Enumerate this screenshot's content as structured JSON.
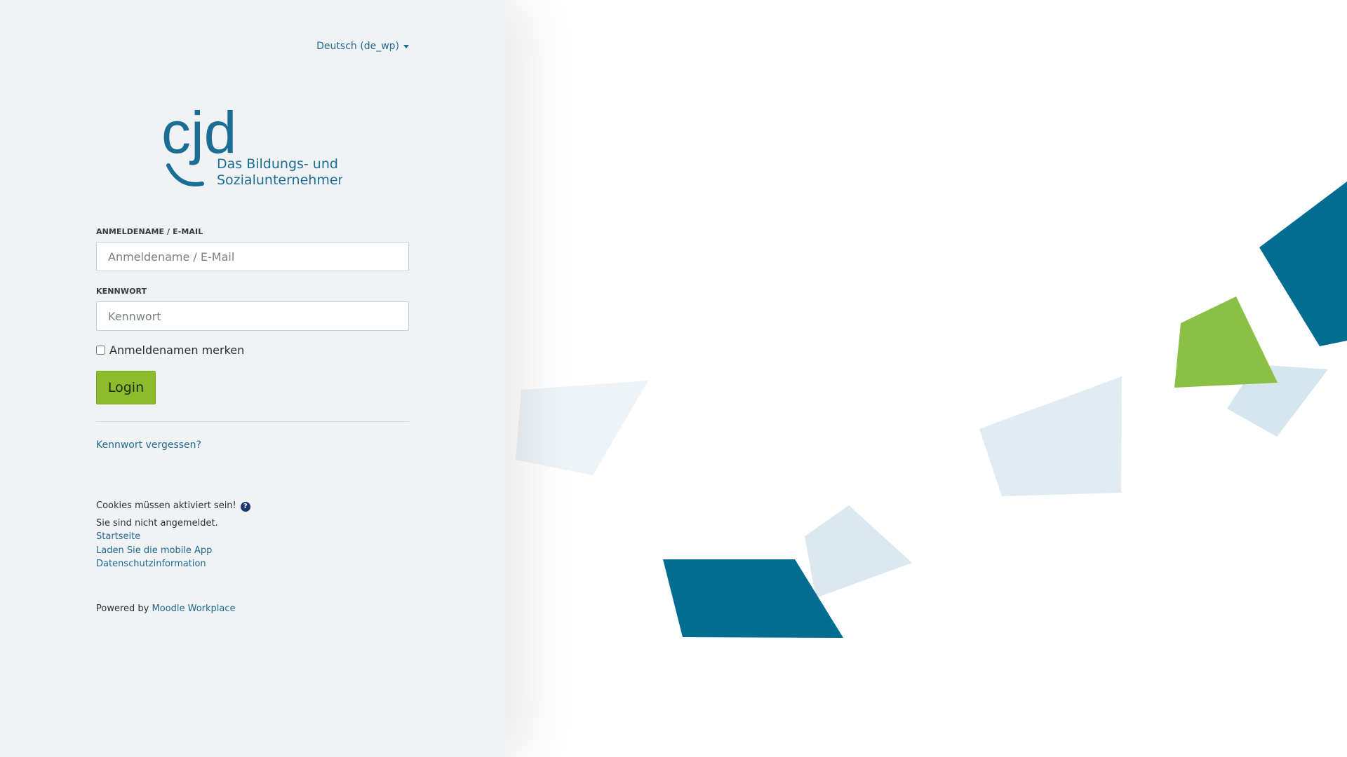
{
  "language_menu": {
    "label": "Deutsch (de_wp)"
  },
  "logo": {
    "wordmark": "cjd",
    "tagline_line1": "Das Bildungs- und",
    "tagline_line2": "Sozialunternehmen",
    "color": "#1a6e96"
  },
  "login_form": {
    "username": {
      "label": "ANMELDENAME / E-MAIL",
      "placeholder": "Anmeldename / E-Mail",
      "value": ""
    },
    "password": {
      "label": "KENNWORT",
      "placeholder": "Kennwort",
      "value": ""
    },
    "remember": {
      "label": "Anmeldenamen merken",
      "checked": false
    },
    "submit_label": "Login",
    "forgot_link": "Kennwort vergessen?"
  },
  "info": {
    "cookies_notice": "Cookies müssen aktiviert sein!",
    "login_status": "Sie sind nicht angemeldet.",
    "links": {
      "home": "Startseite",
      "mobile_app": "Laden Sie die mobile App",
      "privacy": "Datenschutzinformation"
    }
  },
  "footer": {
    "powered_prefix": "Powered by",
    "powered_link": "Moodle Workplace"
  },
  "colors": {
    "brand_blue": "#006d91",
    "brand_green": "#8cbb2b",
    "light_shape": "#dbe8ef",
    "panel_bg": "#f1f2f4"
  }
}
